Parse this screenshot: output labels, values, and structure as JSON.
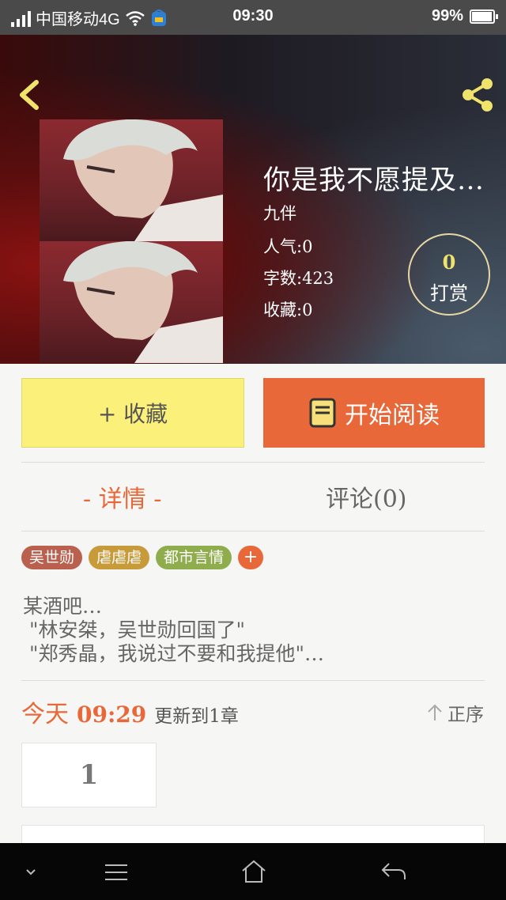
{
  "status_bar": {
    "carrier": "中国移动4G",
    "time": "09:30",
    "battery": "99%"
  },
  "book": {
    "title": "你是我不愿提及…",
    "author": "九伴",
    "popularity": "人气:0",
    "word_count": "字数:423",
    "favorites": "收藏:0"
  },
  "reward": {
    "count": "0",
    "label": "打赏"
  },
  "actions": {
    "favorite_label": "+ 收藏",
    "read_label": "开始阅读"
  },
  "tabs": {
    "detail": "- 详情 -",
    "comments": "评论(0)"
  },
  "tags": [
    "吴世勋",
    "虐虐虐",
    "都市言情"
  ],
  "tag_add": "+",
  "tag_colors": [
    "#b9614e",
    "#c79a3a",
    "#8fad4d",
    "#e9683a"
  ],
  "synopsis": "某酒吧…\n \"林安桀，吴世勋回国了\"\n \"郑秀晶，我说过不要和我提他\"…",
  "update": {
    "day": "今天",
    "time": "09:29",
    "text": "更新到1章",
    "sort_label": "正序"
  },
  "chapters": [
    "1"
  ],
  "icons": {
    "back": "chevron-left-icon",
    "share": "share-icon",
    "book": "book-icon",
    "sort": "arrow-up-icon",
    "nav": [
      "chevron-down-icon",
      "menu-icon",
      "home-icon",
      "back-arrow-icon"
    ]
  },
  "colors": {
    "accent": "#e9683a",
    "favorite_bg": "#fbf07a",
    "icon_yellow": "#f0e36b"
  }
}
